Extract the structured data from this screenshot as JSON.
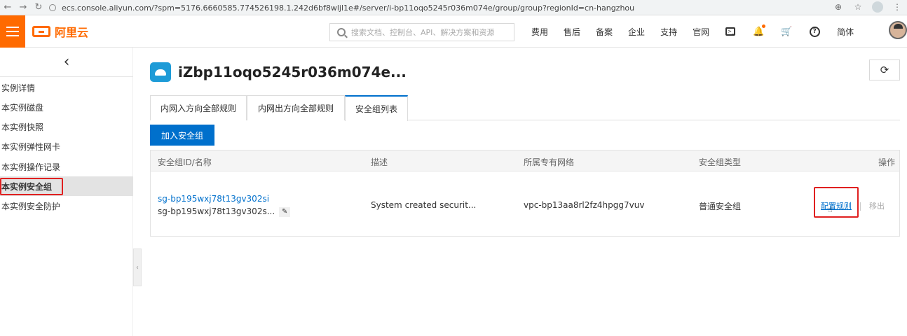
{
  "browser": {
    "url": "ecs.console.aliyun.com/?spm=5176.6660585.774526198.1.242d6bf8wljl1e#/server/i-bp11oqo5245r036m074e/group/group?regionId=cn-hangzhou"
  },
  "header": {
    "logo_text": "阿里云",
    "search_placeholder": "搜索文档、控制台、API、解决方案和资源",
    "nav": [
      "费用",
      "售后",
      "备案",
      "企业",
      "支持",
      "官网"
    ],
    "lang": "简体"
  },
  "sidebar": {
    "items": [
      {
        "label": "实例详情"
      },
      {
        "label": "本实例磁盘"
      },
      {
        "label": "本实例快照"
      },
      {
        "label": "本实例弹性网卡"
      },
      {
        "label": "本实例操作记录"
      },
      {
        "label": "本实例安全组"
      },
      {
        "label": "本实例安全防护"
      }
    ]
  },
  "main": {
    "title": "iZbp11oqo5245r036m074e...",
    "tabs": [
      {
        "label": "内网入方向全部规则"
      },
      {
        "label": "内网出方向全部规则"
      },
      {
        "label": "安全组列表"
      }
    ],
    "add_button": "加入安全组",
    "table": {
      "headers": [
        "安全组ID/名称",
        "描述",
        "所属专有网络",
        "安全组类型",
        "操作"
      ],
      "rows": [
        {
          "id": "sg-bp195wxj78t13gv302si",
          "name": "sg-bp195wxj78t13gv302s...",
          "description": "System created securit...",
          "vpc": "vpc-bp13aa8rl2fz4hpgg7vuv",
          "type": "普通安全组",
          "action_config": "配置规则",
          "action_remove": "移出"
        }
      ]
    }
  },
  "colors": {
    "brand": "#ff6a00",
    "primary": "#0070cc",
    "highlight": "#e02020"
  }
}
